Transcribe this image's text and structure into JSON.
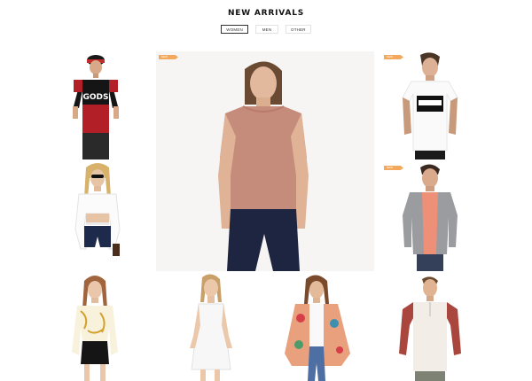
{
  "section": {
    "title": "NEW ARRIVALS"
  },
  "filters": [
    {
      "label": "WOMEN",
      "active": true
    },
    {
      "label": "MEN",
      "active": false
    },
    {
      "label": "OTHER",
      "active": false
    }
  ],
  "colors": {
    "badge": "#f3a85b",
    "active_border": "#333333"
  },
  "products": [
    {
      "id": "black-red-tee",
      "badge": ""
    },
    {
      "id": "rose-knit-top",
      "badge": "new"
    },
    {
      "id": "advisory-tee",
      "badge": "new"
    },
    {
      "id": "white-crop-top",
      "badge": ""
    },
    {
      "id": "grey-cardigan",
      "badge": "new"
    },
    {
      "id": "gold-print-top",
      "badge": ""
    },
    {
      "id": "white-slip-dress",
      "badge": ""
    },
    {
      "id": "floral-kimono",
      "badge": ""
    },
    {
      "id": "raglan-henley",
      "badge": ""
    }
  ]
}
